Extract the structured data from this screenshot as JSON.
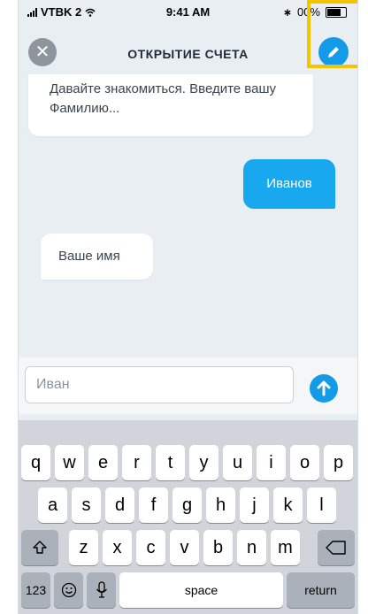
{
  "status_bar": {
    "carrier": "VTBK 2",
    "time": "9:41 AM",
    "battery": "00%",
    "battery_level": 0.8
  },
  "header": {
    "title": "ОТКРЫТИЕ СЧЕТА",
    "close_icon": "close-icon",
    "edit_icon": "pencil-icon"
  },
  "messages": [
    {
      "from": "bot",
      "text": "Давайте знакомиться. Введите вашу Фамилию..."
    },
    {
      "from": "user",
      "text": "Иванов"
    },
    {
      "from": "bot",
      "text": "Ваше имя"
    }
  ],
  "input": {
    "value": "Иван",
    "send_icon": "arrow-up-icon"
  },
  "keyboard": {
    "row1": [
      "q",
      "w",
      "e",
      "r",
      "t",
      "y",
      "u",
      "i",
      "o",
      "p"
    ],
    "row2": [
      "a",
      "s",
      "d",
      "f",
      "g",
      "h",
      "j",
      "k",
      "l"
    ],
    "row3": [
      "z",
      "x",
      "c",
      "v",
      "b",
      "n",
      "m"
    ],
    "shift_icon": "shift-icon",
    "backspace_icon": "backspace-icon",
    "numbers_label": "123",
    "emoji_icon": "emoji-icon",
    "mic_icon": "microphone-icon",
    "space_label": "space",
    "return_label": "return"
  },
  "colors": {
    "accent": "#139be8",
    "user_bubble": "#17a8f0",
    "highlight": "#f5c400",
    "chat_bg": "#e9eef3"
  }
}
